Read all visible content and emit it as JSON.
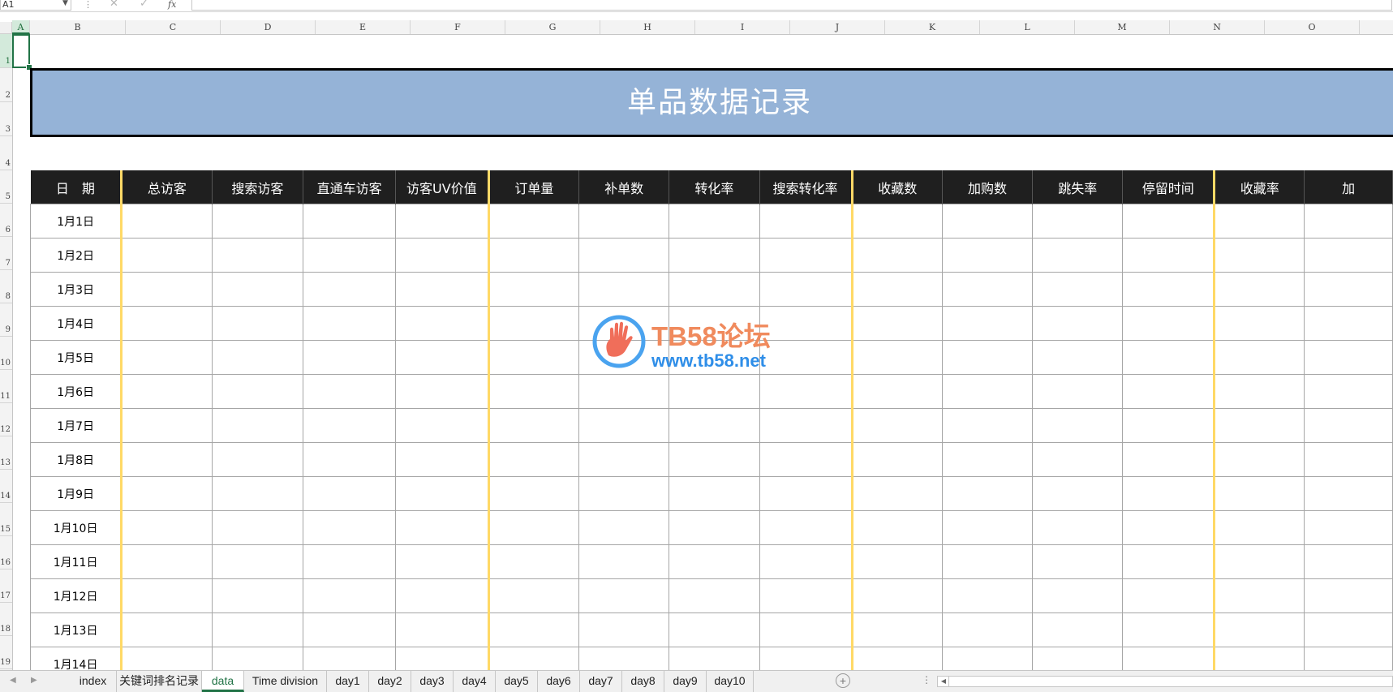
{
  "formula_bar": {
    "name_box": "A1",
    "cancel_icon": "✕",
    "confirm_icon": "✓",
    "fx_label": "fx",
    "formula": ""
  },
  "columns": [
    "A",
    "B",
    "C",
    "D",
    "E",
    "F",
    "G",
    "H",
    "I",
    "J",
    "K",
    "L",
    "M",
    "N",
    "O"
  ],
  "rows": [
    "1",
    "2",
    "3",
    "4",
    "5",
    "6",
    "7",
    "8",
    "9",
    "10",
    "11",
    "12",
    "13",
    "14",
    "15",
    "16",
    "17",
    "18",
    "19"
  ],
  "banner_title": "单品数据记录",
  "table": {
    "headers": [
      "日　期",
      "总访客",
      "搜索访客",
      "直通车访客",
      "访客UV价值",
      "订单量",
      "补单数",
      "转化率",
      "搜索转化率",
      "收藏数",
      "加购数",
      "跳失率",
      "停留时间",
      "收藏率",
      "加"
    ],
    "dates": [
      "1月1日",
      "1月2日",
      "1月3日",
      "1月4日",
      "1月5日",
      "1月6日",
      "1月7日",
      "1月8日",
      "1月9日",
      "1月10日",
      "1月11日",
      "1月12日",
      "1月13日",
      "1月14日"
    ]
  },
  "watermark": {
    "title": "TB58论坛",
    "url": "www.tb58.net"
  },
  "sheet_tabs": [
    "index",
    "关键词排名记录",
    "data",
    "Time division",
    "day1",
    "day2",
    "day3",
    "day4",
    "day5",
    "day6",
    "day7",
    "day8",
    "day9",
    "day10"
  ],
  "active_sheet": "data",
  "colors": {
    "accent": "#217346",
    "banner": "#95b3d7",
    "header_bg": "#1f1f1f",
    "divider_gold": "#ffd966"
  }
}
